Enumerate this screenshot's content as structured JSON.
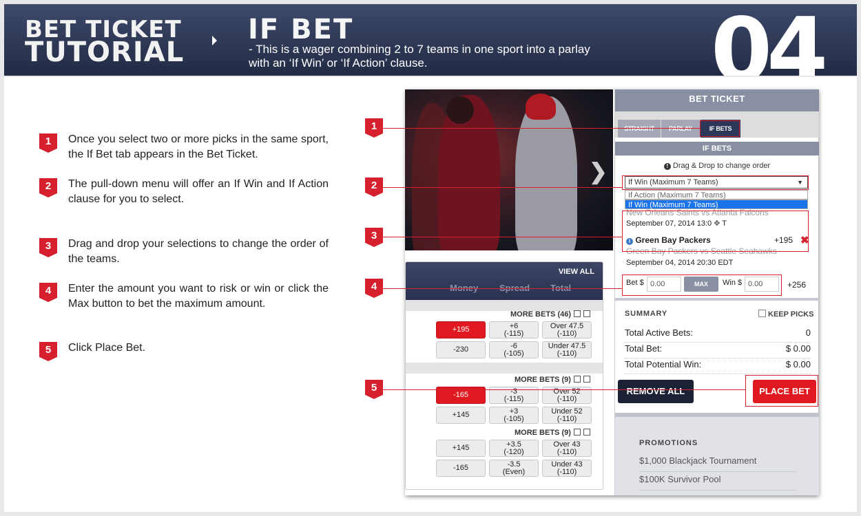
{
  "header": {
    "title_line1": "BET TICKET",
    "title_line2": "TUTORIAL",
    "section_title": "IF BET",
    "description": "- This is a wager combining 2 to 7 teams in one sport into a parlay with an ‘If Win’ or ‘If Action’ clause.",
    "page_number": "04"
  },
  "steps": [
    {
      "num": "1",
      "text": "Once you select two or more picks in the same sport, the If Bet tab appears in the Bet Ticket."
    },
    {
      "num": "2",
      "text": "The pull-down menu will offer an If Win and If Action clause for you to select."
    },
    {
      "num": "3",
      "text": "Drag and drop your selections to change the order of the teams."
    },
    {
      "num": "4",
      "text": "Enter the amount you want to risk or win or click the Max button to bet the maximum amount."
    },
    {
      "num": "5",
      "text": "Click Place Bet."
    }
  ],
  "odds_board": {
    "view_all": "VIEW ALL",
    "columns": [
      "Money",
      "Spread",
      "Total"
    ],
    "groups": [
      {
        "more_bets": "MORE BETS (46)",
        "rows": [
          {
            "money": "+195",
            "spread": [
              "+6",
              "(-115)"
            ],
            "total": [
              "Over 47.5",
              "(-110)"
            ],
            "money_selected": true
          },
          {
            "money": "-230",
            "spread": [
              "-6",
              "(-105)"
            ],
            "total": [
              "Under 47.5",
              "(-110)"
            ],
            "money_selected": false
          }
        ]
      },
      {
        "more_bets": "MORE BETS (9)",
        "rows": [
          {
            "money": "-165",
            "spread": [
              "-3",
              "(-115)"
            ],
            "total": [
              "Over 52",
              "(-110)"
            ],
            "money_selected": true
          },
          {
            "money": "+145",
            "spread": [
              "+3",
              "(-105)"
            ],
            "total": [
              "Under 52",
              "(-110)"
            ],
            "money_selected": false
          }
        ]
      },
      {
        "more_bets": "MORE BETS (9)",
        "rows": [
          {
            "money": "+145",
            "spread": [
              "+3.5",
              "(-120)"
            ],
            "total": [
              "Over 43",
              "(-110)"
            ],
            "money_selected": false
          },
          {
            "money": "-165",
            "spread": [
              "-3.5",
              "(Even)"
            ],
            "total": [
              "Under 43",
              "(-110)"
            ],
            "money_selected": false
          }
        ]
      }
    ]
  },
  "ticket": {
    "title": "BET TICKET",
    "tabs": [
      "STRAIGHT",
      "PARLAY",
      "IF BETS"
    ],
    "active_tab": "IF BETS",
    "section": "IF BETS",
    "drag_hint": "Drag & Drop to change order",
    "select_value": "If Win (Maximum 7 Teams)",
    "options": [
      "If Action (Maximum 7 Teams)",
      "If Win (Maximum 7 Teams)"
    ],
    "game1_ghost": "New Orleans Saints vs Atlanta Falcons",
    "game1_date": "September 07, 2014 13:0",
    "game1_date_tail": "T",
    "pick_team": "Green Bay Packers",
    "pick_odds": "+195",
    "game2_ghost": "Green Bay Packers vs Seattle Seahawks",
    "game2_date": "September 04, 2014 20:30 EDT",
    "bet_label": "Bet $",
    "bet_value": "0.00",
    "max_label": "MAX",
    "win_label": "Win $",
    "win_value": "0.00",
    "to_win_odds": "+256",
    "summary_title": "SUMMARY",
    "keep_picks": "KEEP PICKS",
    "summary_rows": [
      {
        "label": "Total Active Bets:",
        "value": "0"
      },
      {
        "label": "Total Bet:",
        "value": "$ 0.00"
      },
      {
        "label": "Total Potential Win:",
        "value": "$ 0.00"
      }
    ],
    "remove_all": "REMOVE ALL",
    "place_bet": "PLACE BET",
    "promotions_title": "PROMOTIONS",
    "promotions": [
      "$1,000 Blackjack Tournament",
      "$100K Survivor Pool"
    ]
  },
  "callouts": [
    "1",
    "2",
    "3",
    "4",
    "5"
  ],
  "colors": {
    "accent_red": "#d6202e",
    "header_navy": "#2a3350",
    "button_red": "#e0181f"
  }
}
